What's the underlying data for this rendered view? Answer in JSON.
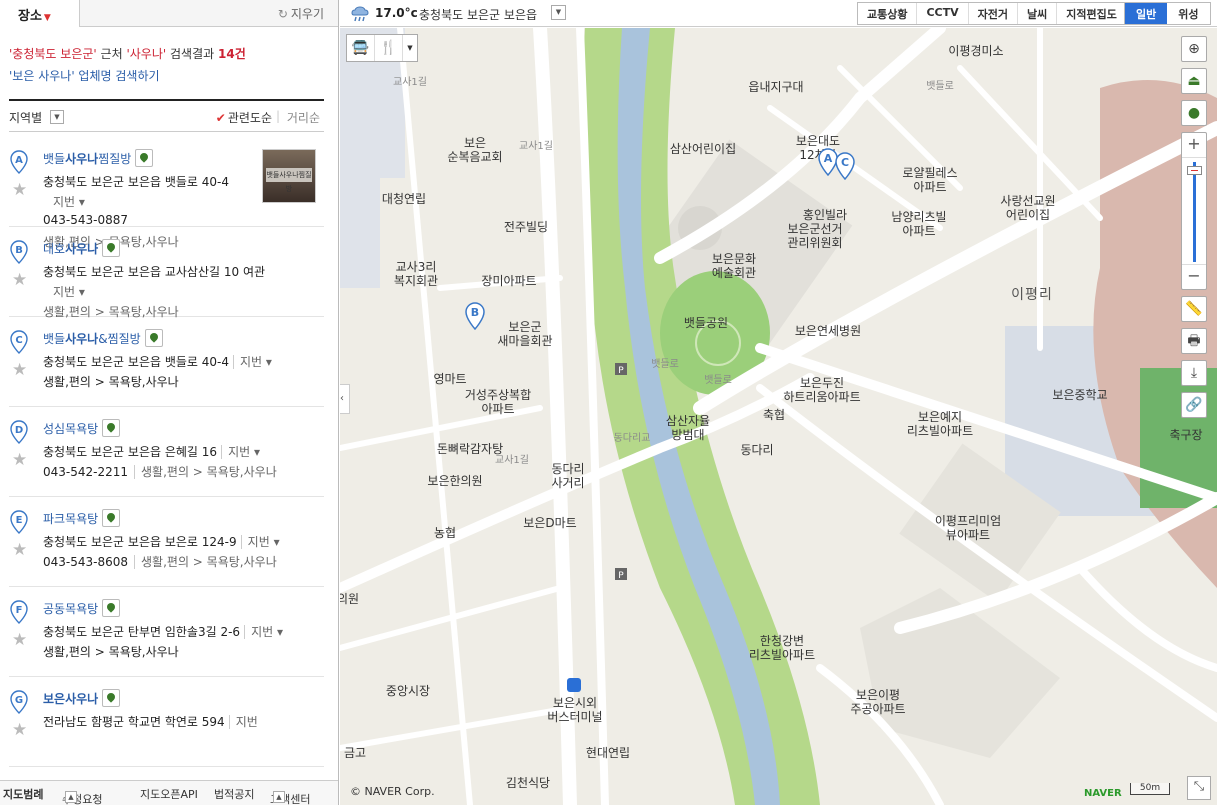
{
  "panel": {
    "tab_label": "장소",
    "clear_label": "지우기",
    "summary": {
      "region": "'충청북도 보은군'",
      "near": "근처",
      "query": "'사우나'",
      "result_text": "검색결과",
      "count": "14건",
      "link": "'보은 사우나' 업체명 검색하기"
    },
    "sort": {
      "region_label": "지역별",
      "relevance": "관련도순",
      "distance": "거리순"
    },
    "results": [
      {
        "letter": "A",
        "pre": "뱃들",
        "hl": "사우나",
        "post": "찜질방",
        "addr": "충청북도 보은군 보은읍 뱃들로 40-4",
        "jibun": "지번",
        "phone": "043-543-0887",
        "cat": "생활,편의 > 목욕탕,사우나",
        "thumb_text": "뱃들사우나찜질방"
      },
      {
        "letter": "B",
        "pre": "대호",
        "hl": "사우나",
        "post": "",
        "addr": "충청북도 보은군 보은읍 교사삼산길 10 여관",
        "jibun": "지번",
        "phone": "",
        "cat": "생활,편의 > 목욕탕,사우나"
      },
      {
        "letter": "C",
        "pre": "뱃들",
        "hl": "사우나",
        "post": "&찜질방",
        "addr": "충청북도 보은군 보은읍 뱃들로 40-4",
        "jibun": "지번",
        "phone": "",
        "cat": "생활,편의 > 목욕탕,사우나"
      },
      {
        "letter": "D",
        "pre": "성심목욕탕",
        "hl": "",
        "post": "",
        "addr": "충청북도 보은군 보은읍 은혜길 16",
        "jibun": "지번",
        "phone": "043-542-2211",
        "cat": "생활,편의 > 목욕탕,사우나"
      },
      {
        "letter": "E",
        "pre": "파크목욕탕",
        "hl": "",
        "post": "",
        "addr": "충청북도 보은군 보은읍 보은로 124-9",
        "jibun": "지번",
        "phone": "043-543-8608",
        "cat": "생활,편의 > 목욕탕,사우나"
      },
      {
        "letter": "F",
        "pre": "공동목욕탕",
        "hl": "",
        "post": "",
        "addr": "충청북도 보은군 탄부면 임한솔3길 2-6",
        "jibun": "지번",
        "phone": "",
        "cat": "생활,편의 > 목욕탕,사우나"
      },
      {
        "letter": "G",
        "pre": "",
        "hl": "보은사우나",
        "post": "",
        "addr": "전라남도 함평군 학교면 학연로 594",
        "jibun": "지번",
        "phone": "",
        "cat": ""
      }
    ],
    "footer": {
      "law": "지도범례",
      "request": "수정요청",
      "api": "지도오픈API",
      "legal": "법적공지",
      "cs": "고객센터"
    }
  },
  "topbar": {
    "temperature": "17.0°c",
    "location": "충청북도 보은군 보은읍",
    "layers": [
      "교통상황",
      "CCTV",
      "자전거",
      "날씨",
      "지적편집도"
    ],
    "map_types": [
      "일반",
      "위성"
    ],
    "active_map_type": "일반"
  },
  "map": {
    "labels": [
      {
        "text": "이평경미소"
      },
      {
        "text": "읍내지구대"
      },
      {
        "text": "보은\n순복음교회"
      },
      {
        "text": "삼산어린이집"
      },
      {
        "text": "보은대도\n12차아"
      },
      {
        "text": "로얄필레스\n아파트"
      },
      {
        "text": "사랑선교원\n어린이집"
      },
      {
        "text": "대청연립"
      },
      {
        "text": "전주빌딩"
      },
      {
        "text": "홍인빌라"
      },
      {
        "text": "보은군선거\n관리위원회"
      },
      {
        "text": "남양리츠빌\n아파트"
      },
      {
        "text": "교사3리\n복지회관"
      },
      {
        "text": "장미아파트"
      },
      {
        "text": "보은문화\n예술회관"
      },
      {
        "text": "이평리"
      },
      {
        "text": "보은군\n새마을회관"
      },
      {
        "text": "뱃들공원"
      },
      {
        "text": "보은연세병원"
      },
      {
        "text": "영마트"
      },
      {
        "text": "거성주상복합\n아파트"
      },
      {
        "text": "보은두진\n하트리움아파트"
      },
      {
        "text": "보은중학교"
      },
      {
        "text": "축협"
      },
      {
        "text": "삼산자율\n방범대"
      },
      {
        "text": "보은예지\n리츠빌아파트"
      },
      {
        "text": "돈뼈락감자탕"
      },
      {
        "text": "동다리"
      },
      {
        "text": "축구장"
      },
      {
        "text": "보은한의원"
      },
      {
        "text": "동다리\n사거리"
      },
      {
        "text": "농협"
      },
      {
        "text": "보은D마트"
      },
      {
        "text": "이평프리미엄\n뷰아파트"
      },
      {
        "text": "의원"
      },
      {
        "text": "한청강변\n리츠빌아파트"
      },
      {
        "text": "중앙시장"
      },
      {
        "text": "보은이평\n주공아파트"
      },
      {
        "text": "보은시외\n버스터미널"
      },
      {
        "text": "금고"
      },
      {
        "text": "현대연립"
      },
      {
        "text": "김천식당"
      },
      {
        "text": "교사1길"
      },
      {
        "text": "교사1길"
      },
      {
        "text": "교사1길"
      },
      {
        "text": "뱃들로"
      },
      {
        "text": "뱃들로"
      },
      {
        "text": "동다리교"
      },
      {
        "text": "뱃들로"
      }
    ],
    "markers": [
      "A",
      "B",
      "C"
    ],
    "brand": "NAVER",
    "scale": "50m",
    "copyright": "© NAVER Corp."
  }
}
